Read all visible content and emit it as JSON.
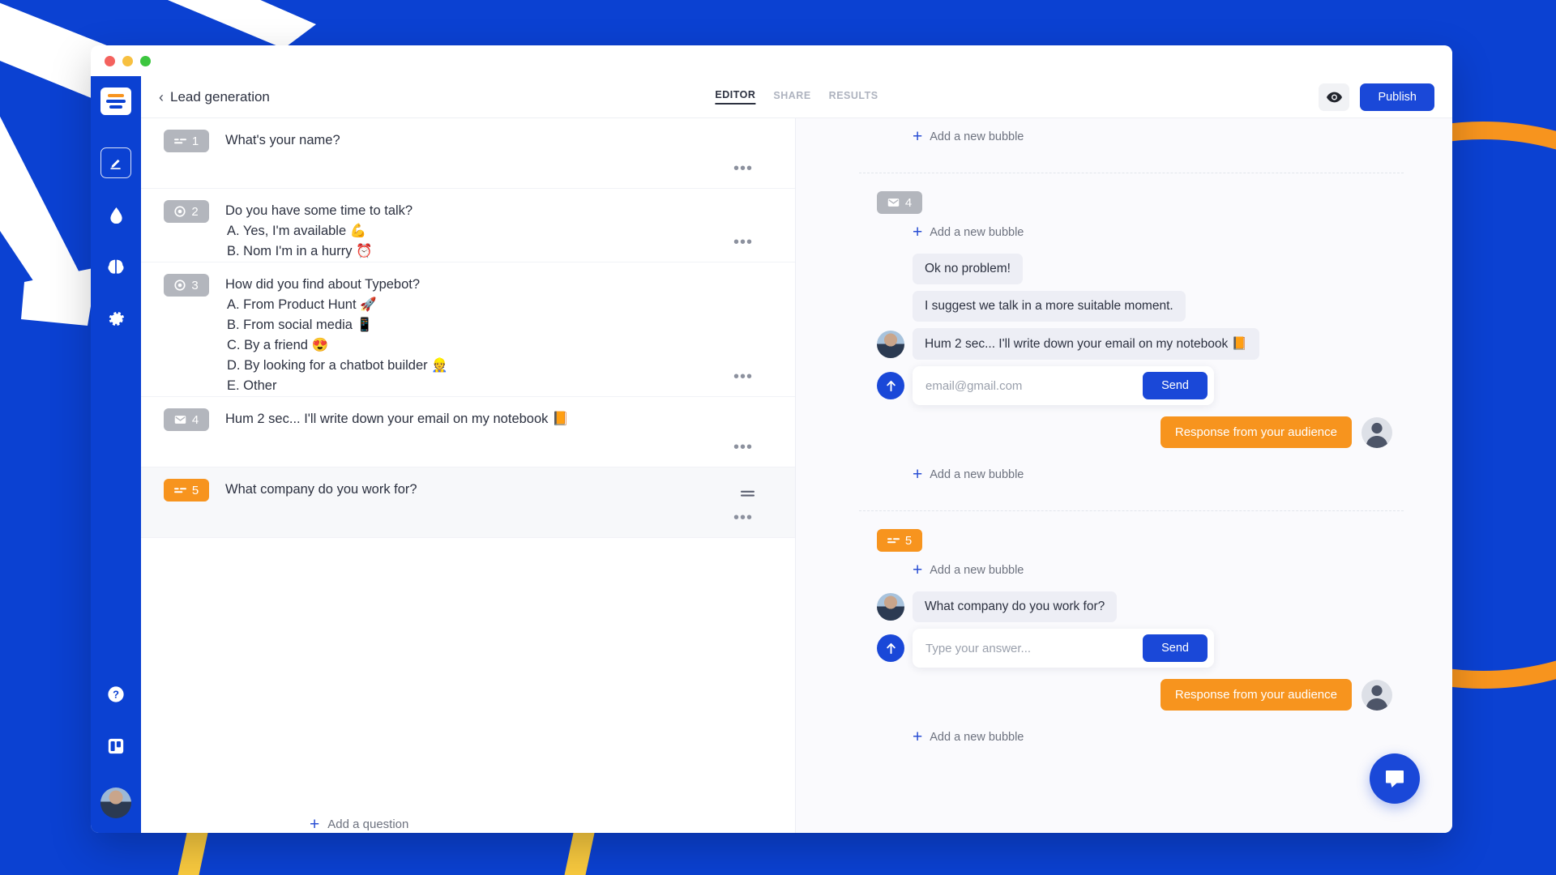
{
  "window": {
    "traffic_lights": [
      "close",
      "minimize",
      "maximize"
    ]
  },
  "header": {
    "back_chevron": "‹",
    "title": "Lead generation",
    "tabs": [
      {
        "label": "EDITOR",
        "active": true
      },
      {
        "label": "SHARE",
        "active": false
      },
      {
        "label": "RESULTS",
        "active": false
      }
    ],
    "preview_icon": "eye-icon",
    "publish_label": "Publish"
  },
  "sidebar": {
    "logo": "typebot-logo",
    "items": [
      {
        "name": "editor",
        "icon": "pencil-square-icon",
        "active": true
      },
      {
        "name": "theme",
        "icon": "droplet-icon",
        "active": false
      },
      {
        "name": "integrations",
        "icon": "brain-icon",
        "active": false
      },
      {
        "name": "settings",
        "icon": "gear-icon",
        "active": false
      }
    ],
    "bottom_items": [
      {
        "name": "help",
        "icon": "question-circle-icon"
      },
      {
        "name": "board",
        "icon": "trello-board-icon"
      },
      {
        "name": "account",
        "icon": "user-avatar"
      }
    ]
  },
  "editor": {
    "blocks": [
      {
        "number": "1",
        "icon": "text-input-icon",
        "accent": "gray",
        "title": "What's your name?",
        "options": [],
        "menu": "•••",
        "selected": false
      },
      {
        "number": "2",
        "icon": "radio-choice-icon",
        "accent": "gray",
        "title": "Do you have some time to talk?",
        "options": [
          "A. Yes, I'm available 💪",
          "B. Nom I'm in a hurry ⏰"
        ],
        "menu": "•••",
        "selected": false
      },
      {
        "number": "3",
        "icon": "radio-choice-icon",
        "accent": "gray",
        "title": "How did you find about Typebot?",
        "options": [
          "A. From Product Hunt 🚀",
          "B. From social media 📱",
          "C. By a friend 😍",
          "D. By looking for a chatbot builder 👷",
          "E. Other"
        ],
        "menu": "•••",
        "selected": false
      },
      {
        "number": "4",
        "icon": "email-envelope-icon",
        "accent": "gray",
        "title": "Hum 2 sec... I'll write down your email on my notebook 📙",
        "options": [],
        "menu": "•••",
        "selected": false
      },
      {
        "number": "5",
        "icon": "text-input-icon",
        "accent": "orange",
        "title": "What company do you work for?",
        "options": [],
        "menu": "•••",
        "drag_handle": "drag-handle-icon",
        "selected": true
      }
    ],
    "add_question_label": "Add a question"
  },
  "preview": {
    "add_bubble_label": "Add a new bubble",
    "groups": [
      {
        "badge_number": "4",
        "badge_icon": "email-envelope-icon",
        "badge_accent": "gray",
        "messages": [
          {
            "kind": "bot-bubble",
            "text": "Ok no problem!"
          },
          {
            "kind": "bot-bubble",
            "text": "I suggest we talk in a more suitable moment."
          },
          {
            "kind": "bot-bubble-avatar",
            "text": "Hum 2 sec... I'll write down your email on my notebook 📙"
          }
        ],
        "input": {
          "placeholder": "email@gmail.com",
          "value": "",
          "send_label": "Send"
        },
        "response": {
          "text": "Response from your audience"
        }
      },
      {
        "badge_number": "5",
        "badge_icon": "text-input-icon",
        "badge_accent": "orange",
        "messages": [
          {
            "kind": "bot-bubble-avatar",
            "text": "What company do you work for?"
          }
        ],
        "input": {
          "placeholder": "Type your answer...",
          "value": "",
          "send_label": "Send"
        },
        "response": {
          "text": "Response from your audience"
        }
      }
    ],
    "fab_icon": "chat-bubble-icon"
  },
  "colors": {
    "brand_blue": "#0B41D2",
    "action_blue": "#1A48D8",
    "accent_orange": "#F7941E",
    "badge_gray": "#B3B6BD",
    "yellow_stripe": "#F9CA3F"
  }
}
